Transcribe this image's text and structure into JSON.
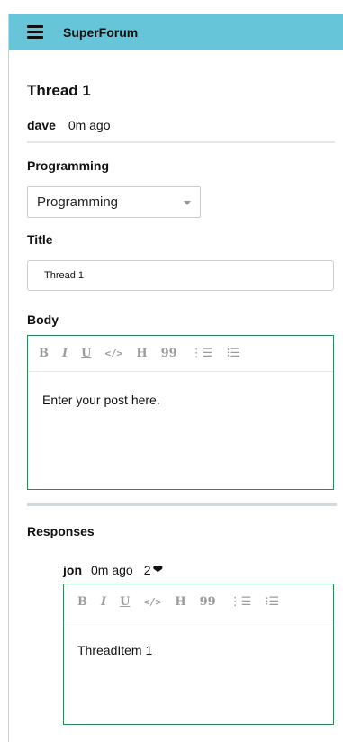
{
  "nav": {
    "brand": "SuperForum",
    "menu_icon": "hamburger-menu-icon"
  },
  "thread": {
    "title": "Thread 1",
    "author": "dave",
    "time_ago": "0m ago"
  },
  "form": {
    "category_label": "Programming",
    "category_selected": "Programming",
    "title_label": "Title",
    "title_value": "Thread 1",
    "body_label": "Body",
    "body_placeholder": "Enter your post here."
  },
  "toolbar": {
    "bold": "B",
    "italic": "I",
    "underline": "U",
    "code": "</>",
    "heading": "H",
    "quote": "99",
    "ordered_list": "⋮☰",
    "bulleted_list": "⁝☰"
  },
  "responses": {
    "label": "Responses",
    "items": [
      {
        "author": "jon",
        "time_ago": "0m ago",
        "likes": "2",
        "like_icon": "heart-icon",
        "body": "ThreadItem 1"
      }
    ]
  },
  "colors": {
    "navbar": "#67c5d9",
    "editor_border": "#2e8b57"
  }
}
